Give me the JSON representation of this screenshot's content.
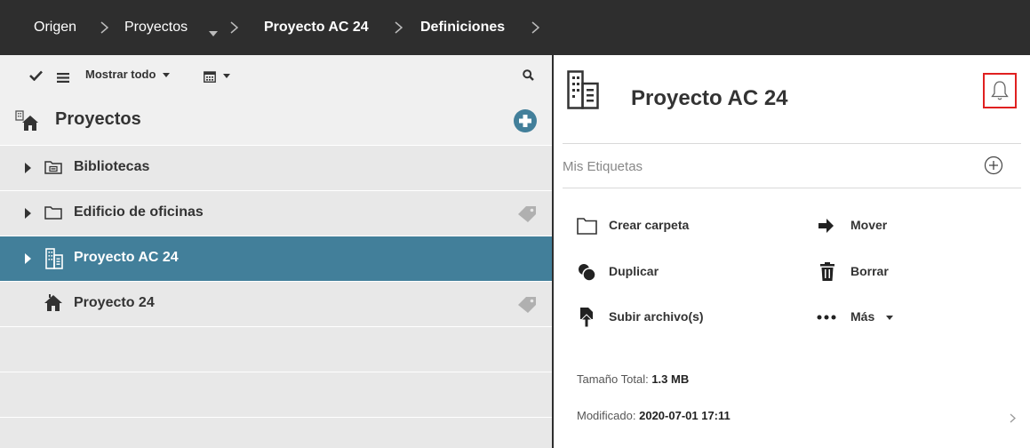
{
  "breadcrumb": {
    "items": [
      "Origen",
      "Proyectos",
      "Proyecto AC 24",
      "Definiciones"
    ]
  },
  "toolbar": {
    "filter_label": "Mostrar todo"
  },
  "sidebar": {
    "title": "Proyectos",
    "items": [
      {
        "label": "Bibliotecas",
        "icon": "library-folder-icon",
        "expandable": true,
        "tag": false,
        "selected": false
      },
      {
        "label": "Edificio de oficinas",
        "icon": "folder-icon",
        "expandable": true,
        "tag": true,
        "selected": false
      },
      {
        "label": "Proyecto AC 24",
        "icon": "building-icon",
        "expandable": true,
        "tag": false,
        "selected": true
      },
      {
        "label": "Proyecto 24",
        "icon": "house-icon",
        "expandable": false,
        "tag": true,
        "selected": false
      }
    ]
  },
  "detail": {
    "title": "Proyecto AC 24",
    "tags_label": "Mis Etiquetas",
    "actions": {
      "create_folder": "Crear carpeta",
      "move": "Mover",
      "duplicate": "Duplicar",
      "delete": "Borrar",
      "upload": "Subir archivo(s)",
      "more": "Más"
    },
    "size_label": "Tamaño Total:",
    "size_value": "1.3 MB",
    "modified_label": "Modificado:",
    "modified_value": "2020-07-01 17:11"
  },
  "colors": {
    "topbar": "#2e2e2e",
    "selected_row": "#427f9a",
    "add_button": "#427f9a",
    "highlight_box": "#e02020"
  }
}
